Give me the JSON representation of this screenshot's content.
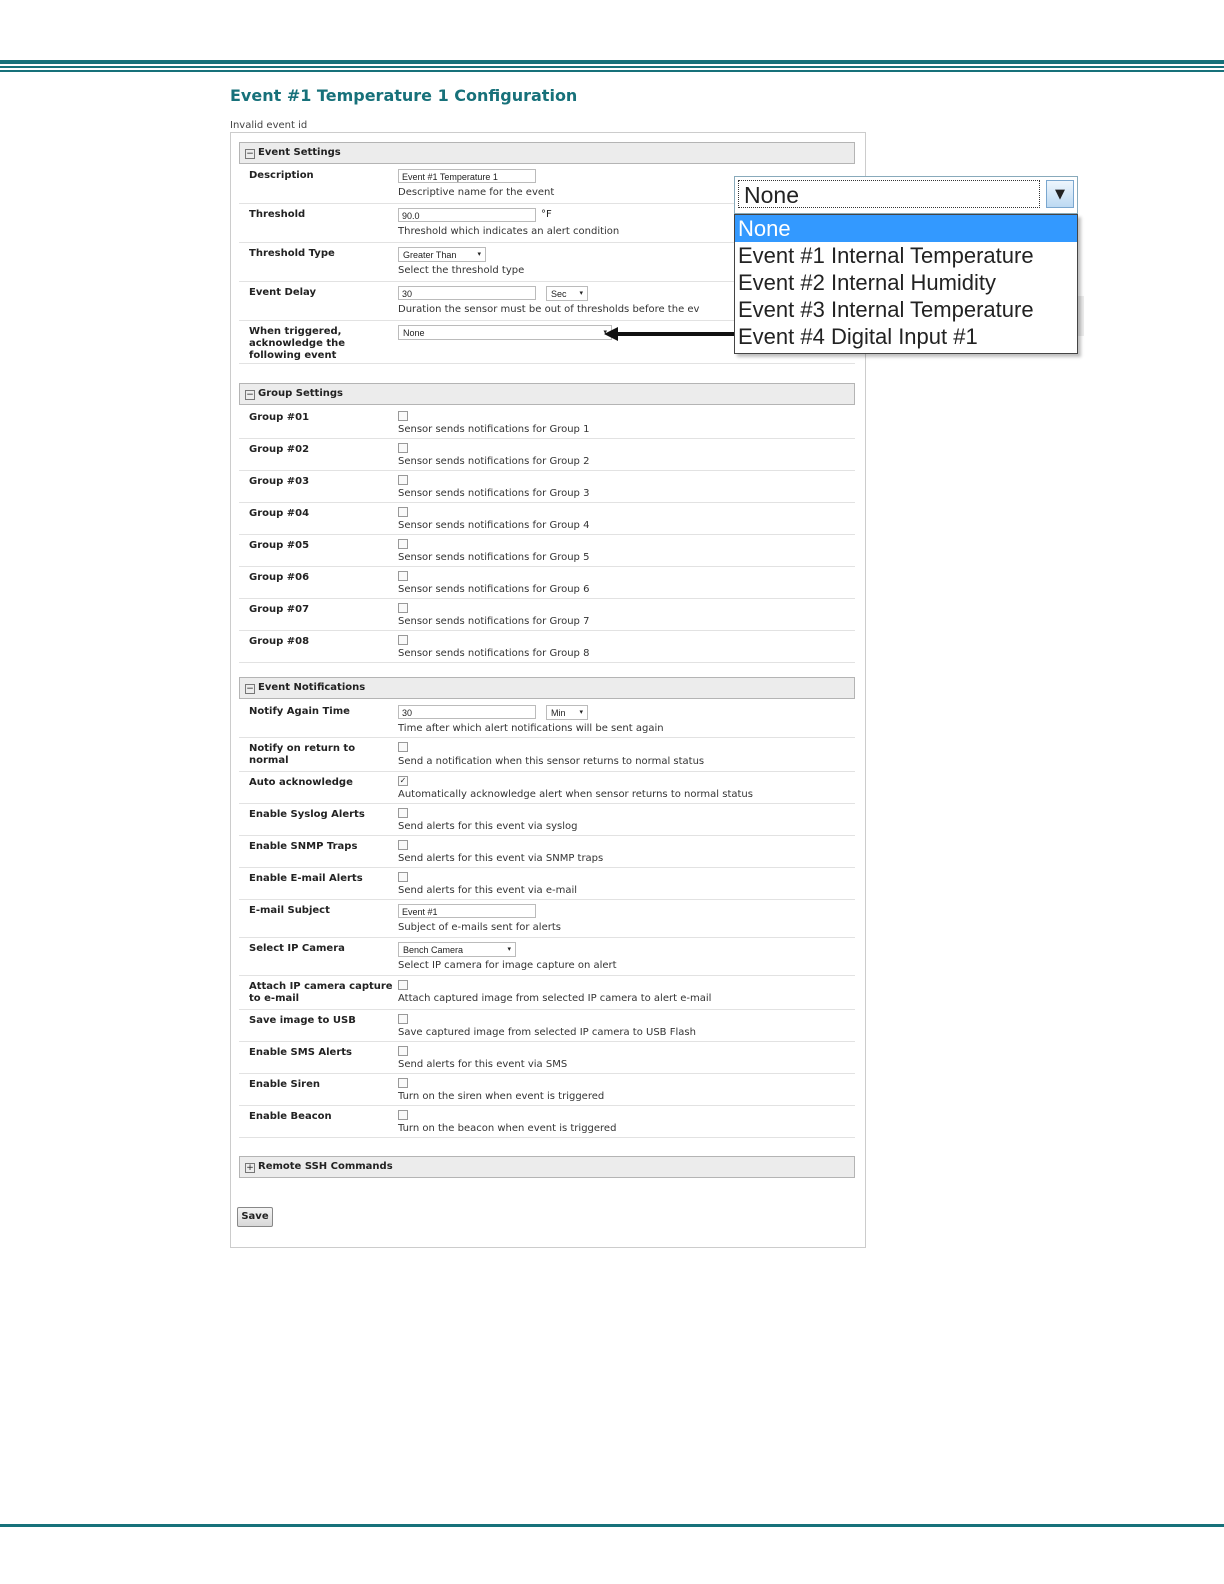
{
  "page": {
    "title": "Event #1 Temperature 1 Configuration",
    "error": "Invalid event id"
  },
  "event_settings": {
    "header": "Event Settings",
    "toggle": "−",
    "description": {
      "label": "Description",
      "value": "Event #1 Temperature 1",
      "help": "Descriptive name for the event"
    },
    "threshold": {
      "label": "Threshold",
      "value": "90.0",
      "unit": "°F",
      "help": "Threshold which indicates an alert condition"
    },
    "threshold_type": {
      "label": "Threshold Type",
      "value": "Greater Than",
      "help": "Select the threshold type"
    },
    "event_delay": {
      "label": "Event Delay",
      "value": "30",
      "unit": "Sec",
      "help": "Duration the sensor must be out of thresholds before the ev"
    },
    "ack_event": {
      "label": "When triggered, acknowledge the following event",
      "value": "None"
    }
  },
  "group_settings": {
    "header": "Group Settings",
    "toggle": "−",
    "groups": [
      {
        "label": "Group #01",
        "help": "Sensor sends notifications for Group 1"
      },
      {
        "label": "Group #02",
        "help": "Sensor sends notifications for Group 2"
      },
      {
        "label": "Group #03",
        "help": "Sensor sends notifications for Group 3"
      },
      {
        "label": "Group #04",
        "help": "Sensor sends notifications for Group 4"
      },
      {
        "label": "Group #05",
        "help": "Sensor sends notifications for Group 5"
      },
      {
        "label": "Group #06",
        "help": "Sensor sends notifications for Group 6"
      },
      {
        "label": "Group #07",
        "help": "Sensor sends notifications for Group 7"
      },
      {
        "label": "Group #08",
        "help": "Sensor sends notifications for Group 8"
      }
    ]
  },
  "event_notifications": {
    "header": "Event Notifications",
    "toggle": "−",
    "notify_again": {
      "label": "Notify Again Time",
      "value": "30",
      "unit": "Min",
      "help": "Time after which alert notifications will be sent again"
    },
    "notify_return": {
      "label": "Notify on return to normal",
      "help": "Send a notification when this sensor returns to normal status",
      "checked": false
    },
    "auto_ack": {
      "label": "Auto acknowledge",
      "help": "Automatically acknowledge alert when sensor returns to normal status",
      "checked": true,
      "mark": "✓"
    },
    "syslog": {
      "label": "Enable Syslog Alerts",
      "help": "Send alerts for this event via syslog"
    },
    "snmp": {
      "label": "Enable SNMP Traps",
      "help": "Send alerts for this event via SNMP traps"
    },
    "email": {
      "label": "Enable E-mail Alerts",
      "help": "Send alerts for this event via e-mail"
    },
    "email_subject": {
      "label": "E-mail Subject",
      "value": "Event #1",
      "help": "Subject of e-mails sent for alerts"
    },
    "ip_camera": {
      "label": "Select IP Camera",
      "value": "Bench Camera",
      "help": "Select IP camera for image capture on alert"
    },
    "attach_capture": {
      "label": "Attach IP camera capture to e-mail",
      "help": "Attach captured image from selected IP camera to alert e-mail"
    },
    "save_usb": {
      "label": "Save image to USB",
      "help": "Save captured image from selected IP camera to USB Flash"
    },
    "sms": {
      "label": "Enable SMS Alerts",
      "help": "Send alerts for this event via SMS"
    },
    "siren": {
      "label": "Enable Siren",
      "help": "Turn on the siren when event is triggered"
    },
    "beacon": {
      "label": "Enable Beacon",
      "help": "Turn on the beacon when event is triggered"
    }
  },
  "remote_ssh": {
    "header": "Remote SSH Commands",
    "toggle": "+"
  },
  "save_label": "Save",
  "callout_dropdown": {
    "selected": "None",
    "options": [
      "None",
      "Event #1 Internal Temperature",
      "Event #2 Internal Humidity",
      "Event #3 Internal Temperature",
      "Event #4 Digital Input #1"
    ]
  },
  "icons": {
    "dropdown_arrow": "▾",
    "callout_arrow": "▼"
  },
  "colors": {
    "accent": "#17717a",
    "highlight": "#3399ff"
  }
}
